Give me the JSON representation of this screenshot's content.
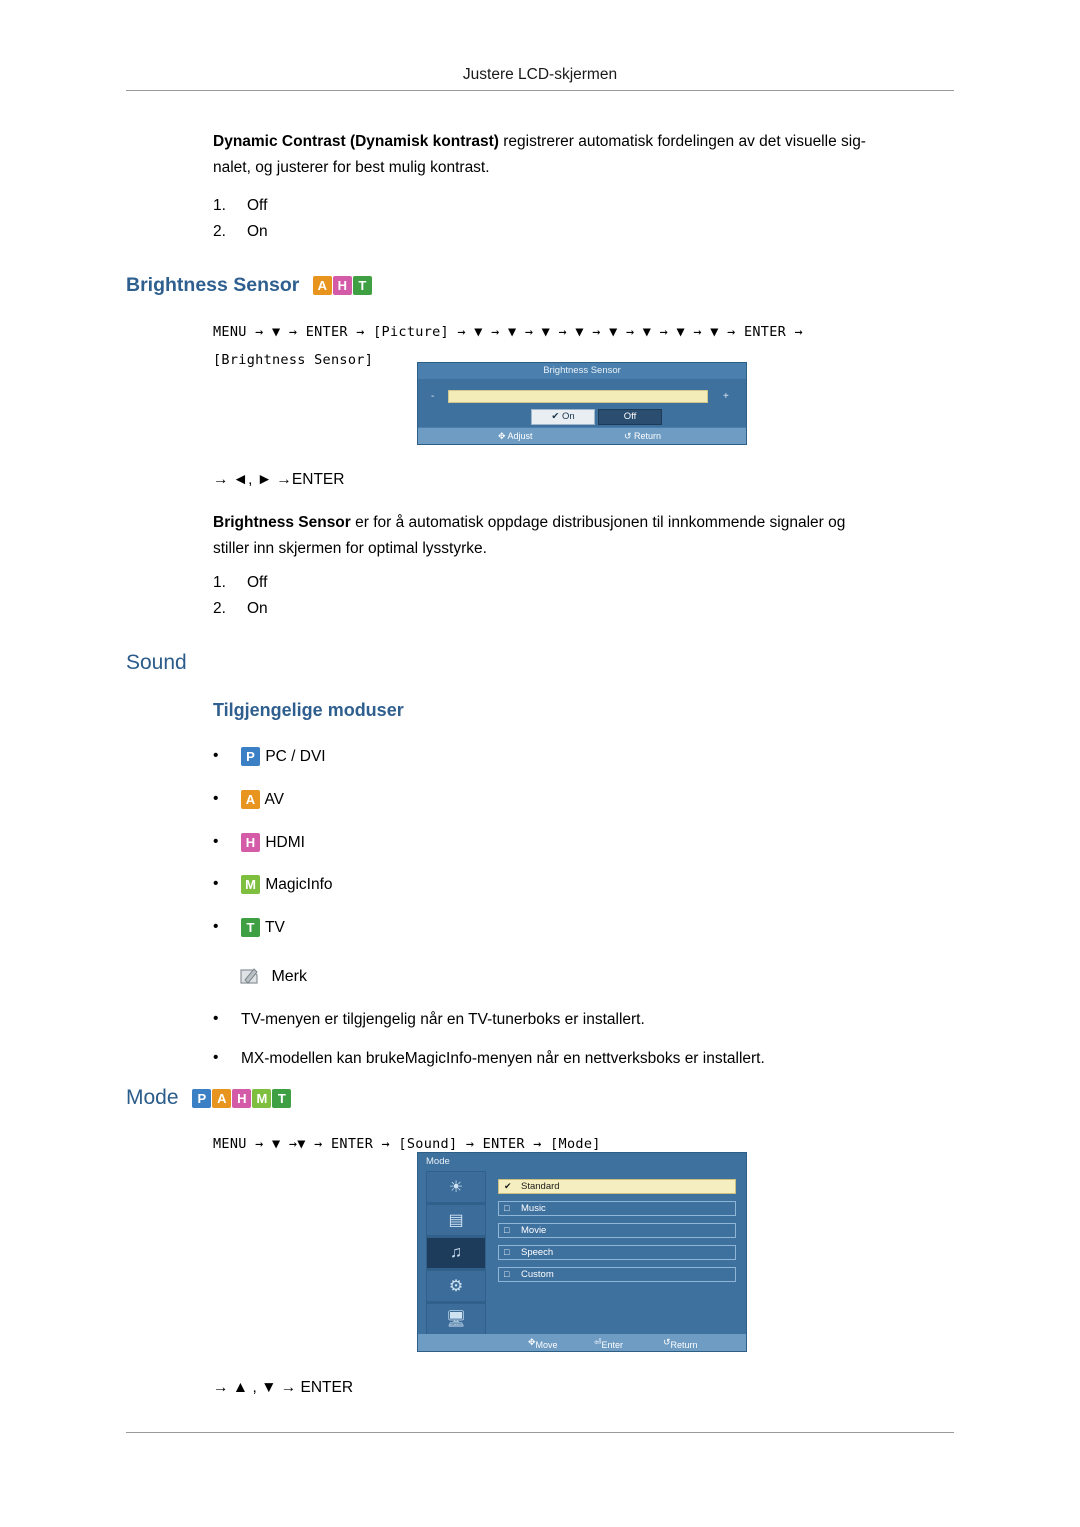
{
  "header": {
    "title": "Justere LCD-skjermen"
  },
  "dynamic_contrast": {
    "bold_label": "Dynamic Contrast (Dynamisk kontrast)",
    "text": " registrerer automatisk fordelingen av det visuelle sig-",
    "line2": "nalet, og justerer for best mulig kontrast.",
    "options": [
      {
        "num": "1.",
        "label": "Off"
      },
      {
        "num": "2.",
        "label": "On"
      }
    ]
  },
  "brightness_sensor": {
    "heading": "Brightness Sensor",
    "badges": [
      "A",
      "H",
      "T"
    ],
    "path_line1": "MENU → ▼ → ENTER → [Picture] → ▼ → ▼ → ▼ → ▼ → ▼ → ▼ → ▼ → ▼ → ENTER →",
    "path_line2": "[Brightness Sensor]",
    "osd": {
      "title": "Brightness Sensor",
      "minus": "-",
      "plus": "+",
      "on_label": "On",
      "off_label": "Off",
      "footer_adjust": "Adjust",
      "footer_return": "Return"
    },
    "nav": "→ ◄, ► →ENTER",
    "desc_bold": "Brightness Sensor",
    "desc_text": " er for å automatisk oppdage distribusjonen til innkommende signaler og",
    "desc_line2": "stiller inn skjermen for optimal lysstyrke.",
    "options": [
      {
        "num": "1.",
        "label": "Off"
      },
      {
        "num": "2.",
        "label": "On"
      }
    ]
  },
  "sound": {
    "heading": "Sound",
    "subheading": "Tilgjengelige moduser",
    "modes": [
      {
        "badge": "P",
        "label": "PC / DVI"
      },
      {
        "badge": "A",
        "label": "AV"
      },
      {
        "badge": "H",
        "label": "HDMI"
      },
      {
        "badge": "M",
        "label": "MagicInfo"
      },
      {
        "badge": "T",
        "label": "TV"
      }
    ],
    "note_label": "Merk",
    "notes": [
      "TV-menyen er tilgjengelig når en TV-tunerboks er installert.",
      "MX-modellen kan brukeMagicInfo-menyen når en nettverksboks er installert."
    ]
  },
  "mode": {
    "heading": "Mode",
    "badges": [
      "P",
      "A",
      "H",
      "M",
      "T"
    ],
    "path": "MENU → ▼ →▼ → ENTER → [Sound] → ENTER → [Mode]",
    "osd": {
      "title": "Mode",
      "items": [
        {
          "label": "Standard",
          "active": true
        },
        {
          "label": "Music",
          "active": false
        },
        {
          "label": "Movie",
          "active": false
        },
        {
          "label": "Speech",
          "active": false
        },
        {
          "label": "Custom",
          "active": false
        }
      ],
      "footer_move": "Move",
      "footer_enter": "Enter",
      "footer_return": "Return"
    },
    "nav": "→ ▲ , ▼ → ENTER"
  }
}
